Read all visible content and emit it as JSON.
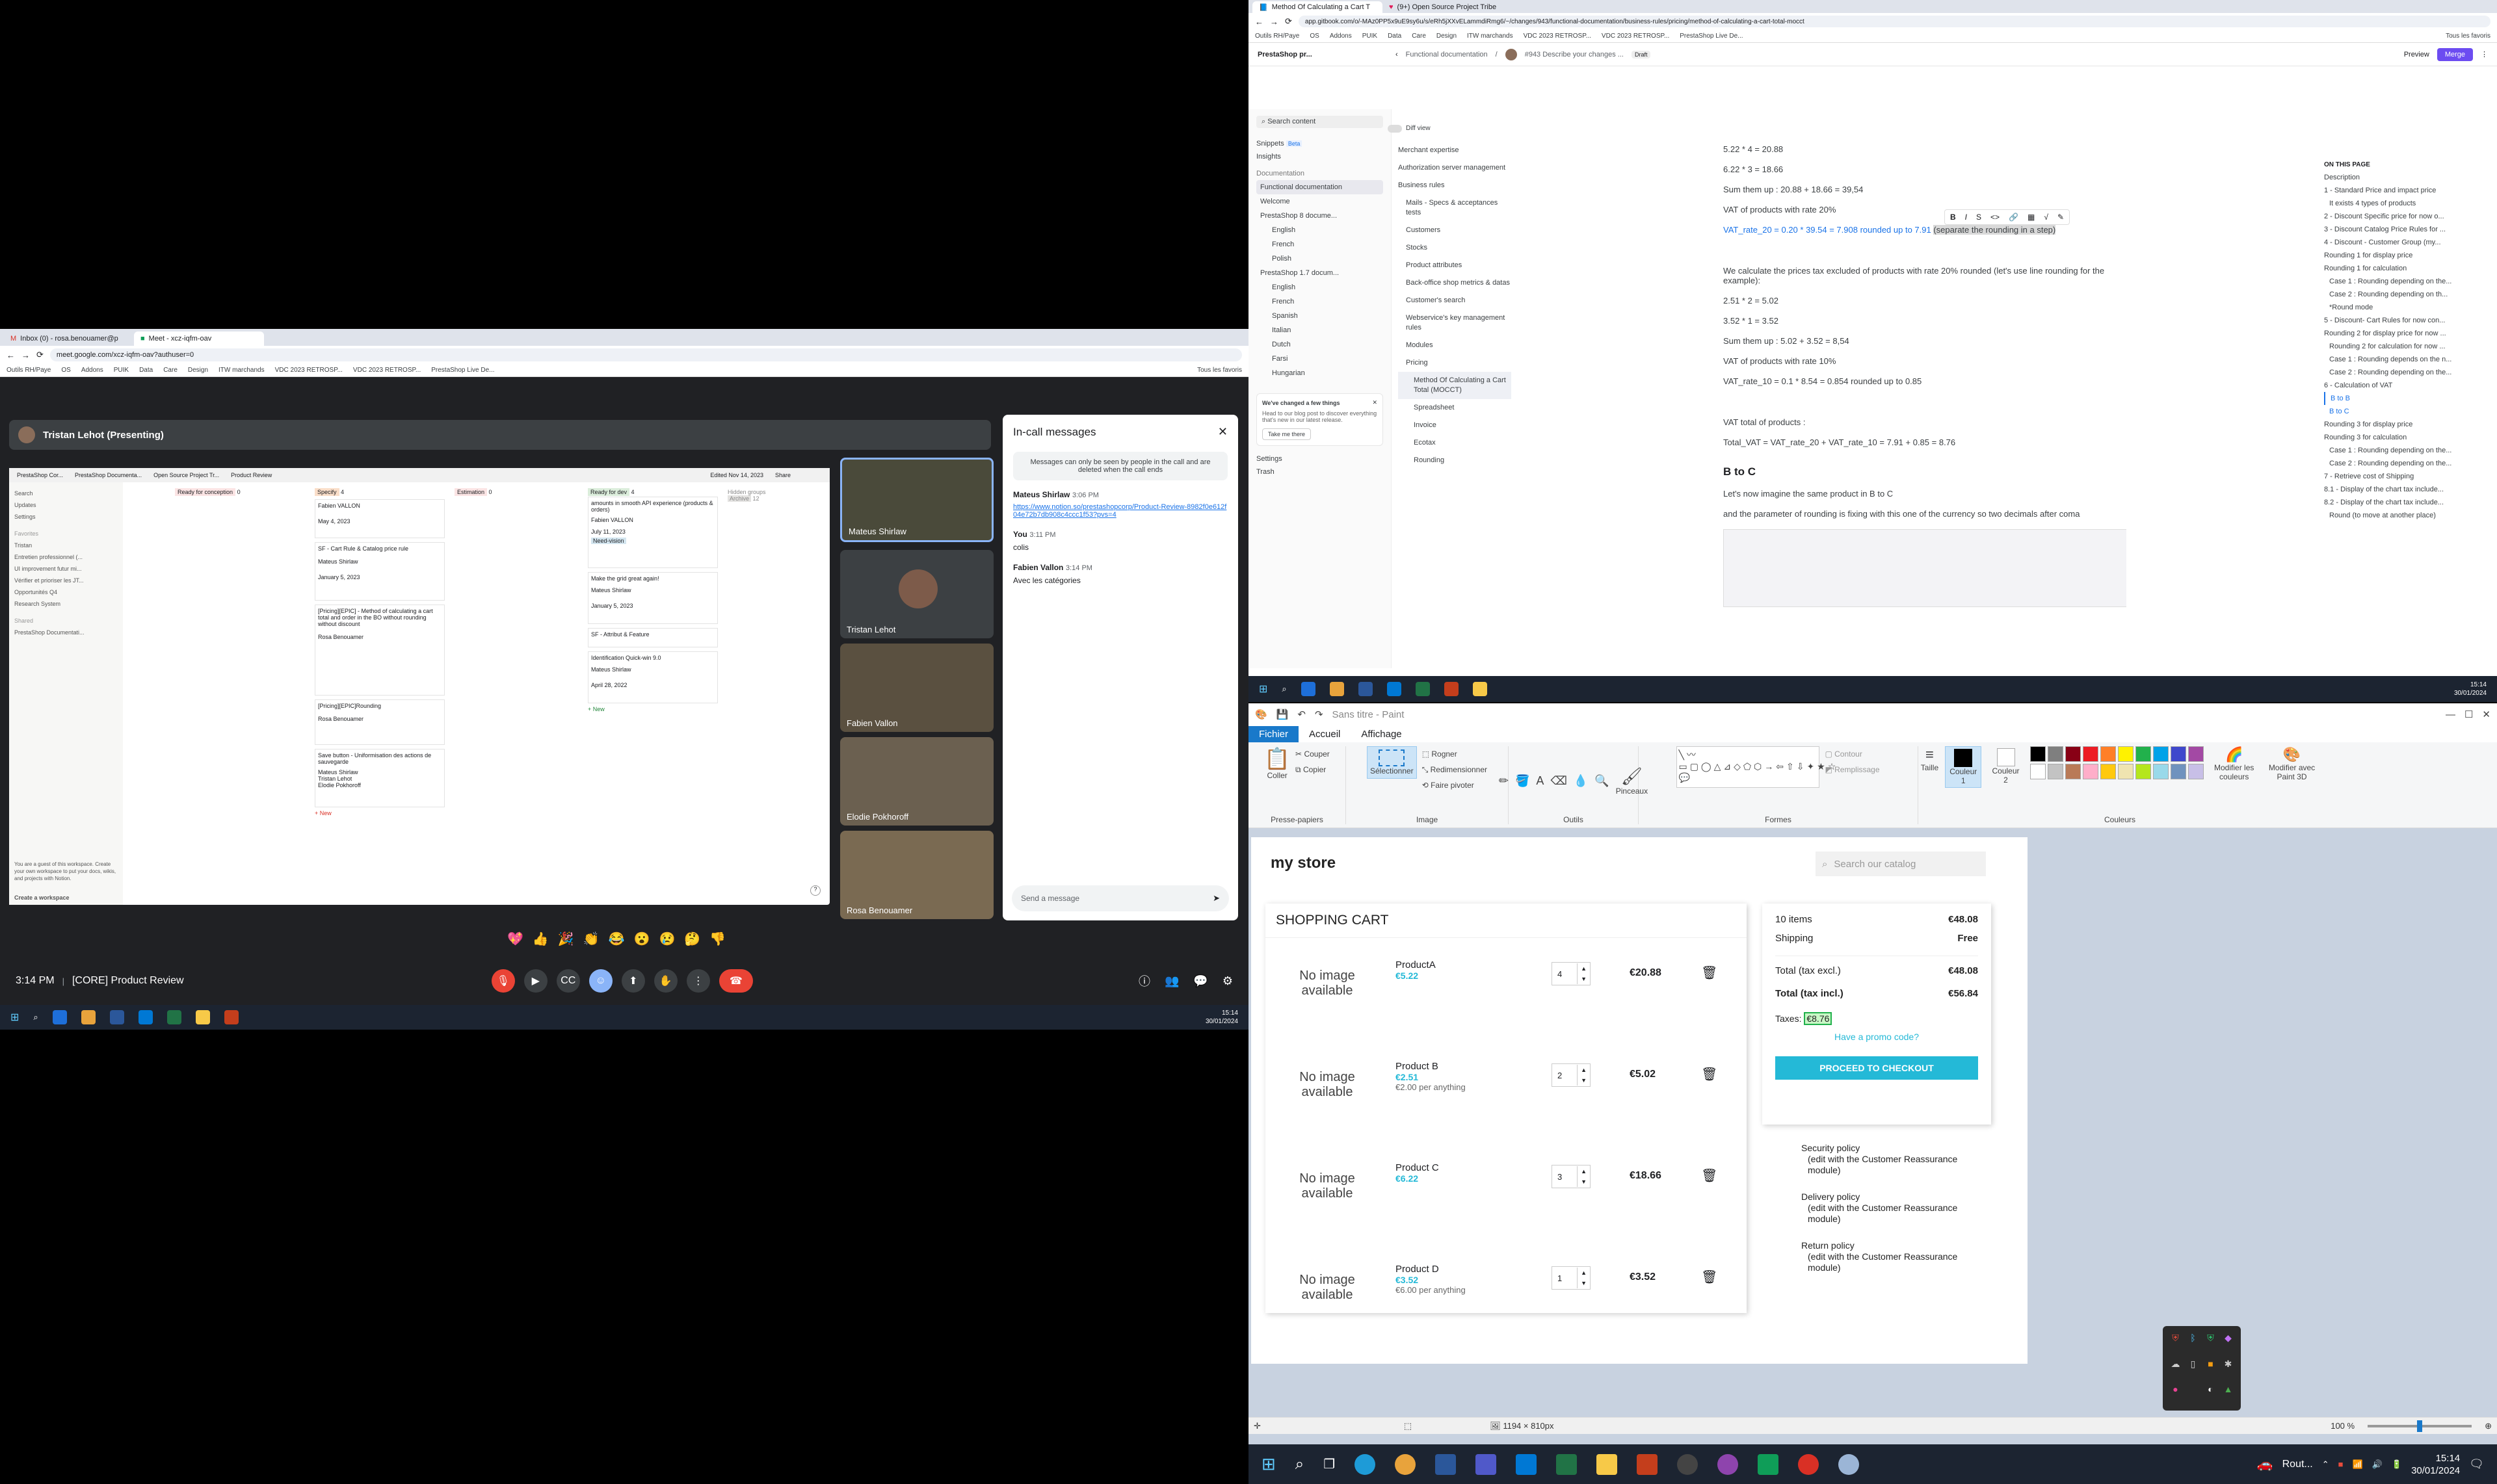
{
  "meet_browser": {
    "tabs": [
      {
        "label": "Inbox (0) - rosa.benouamer@p"
      },
      {
        "label": "Meet - xcz-iqfm-oav"
      }
    ],
    "url": "meet.google.com/xcz-iqfm-oav?authuser=0",
    "bookmarks": [
      "Outils RH/Paye",
      "OS",
      "Addons",
      "PUIK",
      "Data",
      "Care",
      "Design",
      "ITW marchands",
      "VDC 2023 RETROSP...",
      "VDC 2023 RETROSP...",
      "PrestaShop Live De..."
    ],
    "bookmarks_right": "Tous les favoris",
    "presenter": "Tristan Lehot (Presenting)",
    "shared": {
      "tabs": [
        "PrestaShop Cor...",
        "PrestaShop Documenta...",
        "Open Source Project Tr...",
        "Product Review"
      ],
      "edited": "Edited Nov 14, 2023",
      "share": "Share",
      "sidebar": [
        "Search",
        "Updates",
        "Settings",
        "Favorites",
        "Tristan",
        "Entretien professionnel (...",
        "UI improvement futur mi...",
        "Vérifier et prioriser les JT...",
        "Opportunités Q4",
        "Research System",
        "Shared",
        "PrestaShop Documentati..."
      ],
      "guest_note": "You are a guest of this workspace. Create your own workspace to put your docs, wikis, and projects with Notion.",
      "create": "Create a workspace",
      "columns": [
        {
          "title": "Ready for conception",
          "count": "0",
          "cards": []
        },
        {
          "title": "Specify",
          "count": "4",
          "cards": [
            {
              "owner": "Fabien VALLON",
              "date": "May 4, 2023"
            },
            {
              "title": "SF - Cart Rule & Catalog price rule",
              "owner": "Mateus Shirlaw",
              "date": "January 5, 2023"
            },
            {
              "title": "[Pricing][EPIC] - Method of calculating a cart total and order in the BO without rounding without discount",
              "owner": "Rosa Benouamer"
            },
            {
              "title": "[Pricing][EPIC]Rounding",
              "owner": "Rosa Benouamer"
            },
            {
              "title": "Save button - Uniformisation des actions de sauvegarde",
              "owner": "Mateus Shirlaw",
              "owner2": "Tristan Lehot",
              "owner3": "Elodie Pokhoroff"
            }
          ]
        },
        {
          "title": "Estimation",
          "count": "0",
          "cards": []
        },
        {
          "title": "Ready for dev",
          "count": "4",
          "cards": [
            {
              "title": "amounts in smooth API experience (products & orders)",
              "owner": "Fabien VALLON",
              "date": "July 11, 2023",
              "tag": "Need-vision"
            },
            {
              "title": "Make the grid great again!",
              "owner": "Mateus Shirlaw",
              "date": "January 5, 2023"
            },
            {
              "title": "SF - Attribut & Feature"
            },
            {
              "title": "Identification Quick-win 9.0",
              "owner": "Mateus Shirlaw",
              "date": "April 28, 2022"
            }
          ]
        },
        {
          "title": "Hidden groups",
          "count": "",
          "cards": [
            {
              "title": "Archive",
              "count": "12"
            }
          ]
        }
      ],
      "new_label": "+ New",
      "help": "?"
    },
    "participants": [
      {
        "name": "Mateus Shirlaw"
      },
      {
        "name": "Tristan Lehot"
      },
      {
        "name": "Fabien Vallon"
      },
      {
        "name": "Elodie Pokhoroff"
      },
      {
        "name": "Rosa Benouamer"
      }
    ],
    "chat": {
      "title": "In-call messages",
      "notice": "Messages can only be seen by people in the call and are deleted when the call ends",
      "messages": [
        {
          "sender": "Mateus Shirlaw",
          "time": "3:06 PM",
          "text": "https://www.notion.so/prestashopcorp/Product-Review-8982f0e612f04e72b7db908c4ccc1f53?pvs=4"
        },
        {
          "sender": "You",
          "time": "3:11 PM",
          "text": "colis"
        },
        {
          "sender": "Fabien Vallon",
          "time": "3:14 PM",
          "text": "Avec les catégories"
        }
      ],
      "input_placeholder": "Send a message"
    },
    "footer": {
      "time": "3:14 PM",
      "meeting": "[CORE] Product Review"
    },
    "reactions": [
      "💖",
      "👍",
      "🎉",
      "👏",
      "😂",
      "😮",
      "😢",
      "🤔",
      "👎"
    ],
    "taskbar_time": "15:14",
    "taskbar_date": "30/01/2024"
  },
  "gitbook_browser": {
    "tabs": [
      {
        "label": "Method Of Calculating a Cart T"
      },
      {
        "label": "(9+) Open Source Project Tribe"
      }
    ],
    "url": "app.gitbook.com/o/-MAz0PP5x9uE9sy6u/s/eRh5jXXvELammdiRmg6/~/changes/943/functional-documentation/business-rules/pricing/method-of-calculating-a-cart-total-mocct",
    "bookmarks": [
      "Outils RH/Paye",
      "OS",
      "Addons",
      "PUIK",
      "Data",
      "Care",
      "Design",
      "ITW marchands",
      "VDC 2023 RETROSP...",
      "VDC 2023 RETROSP...",
      "PrestaShop Live De..."
    ],
    "bookmarks_right": "Tous les favoris",
    "space": "PrestaShop pr...",
    "breadcrumb": "Functional documentation",
    "change_title": "#943 Describe your changes ...",
    "draft": "Draft",
    "preview": "Preview",
    "merge": "Merge",
    "search": "Search content",
    "diff_view": "Diff view",
    "left_nav": [
      "Snippets",
      "Insights",
      "Documentation",
      "Functional documentation",
      "Welcome",
      "PrestaShop 8 docume...",
      "English",
      "French",
      "Polish",
      "PrestaShop 1.7 docum...",
      "English",
      "French",
      "Spanish",
      "Italian",
      "Dutch",
      "Farsi",
      "Hungarian"
    ],
    "beta": "Beta",
    "promo": {
      "title": "We've changed a few things",
      "text": "Head to our blog post to discover everything that's new in our latest release.",
      "button": "Take me there"
    },
    "settings": "Settings",
    "trash": "Trash",
    "tree": [
      "Merchant expertise",
      "Authorization server management",
      "Business rules",
      "Mails - Specs & acceptances tests",
      "Customers",
      "Stocks",
      "Product attributes",
      "Back-office shop metrics & datas",
      "Customer's search",
      "Webservice's key management rules",
      "Modules",
      "Pricing",
      "Method Of Calculating a Cart Total (MOCCT)",
      "Spreadsheet",
      "Invoice",
      "Ecotax",
      "Rounding"
    ],
    "doc": [
      "5.22 * 4 = 20.88",
      "6.22 * 3 = 18.66",
      "Sum them up : 20.88 + 18.66 = 39,54",
      "VAT of products with rate 20%",
      "VAT_rate_20 = 0.20 * 39.54 = 7.908 rounded up to 7.91",
      "(separate the rounding in a step)",
      "We calculate the prices tax excluded of products with rate 20% rounded (let's use line rounding for the example):",
      "2.51 * 2 = 5.02",
      "3.52 * 1 = 3.52",
      "Sum them up : 5.02 + 3.52 = 8,54",
      "VAT of products with rate 10%",
      "VAT_rate_10 = 0.1 * 8.54 = 0.854 rounded up to 0.85",
      "VAT total of products :",
      "Total_VAT = VAT_rate_20 + VAT_rate_10 = 7.91 + 0.85 = 8.76",
      "B to C",
      "Let's now imagine the same product in B to C",
      "and the parameter of rounding is fixing with this one of the currency so two decimals after coma"
    ],
    "toc_title": "ON THIS PAGE",
    "toc": [
      "Description",
      "1 - Standard Price and impact price",
      "It exists 4 types of products",
      "2 - Discount Specific price for now o...",
      "3 - Discount Catalog Price Rules for ...",
      "4 - Discount - Customer Group (my...",
      "Rounding 1 for display price",
      "Rounding 1 for calculation",
      "Case 1 : Rounding depending on the...",
      "Case 2 : Rounding depending on th...",
      "*Round mode",
      "5 - Discount- Cart Rules for now con...",
      "Rounding 2 for display price for now ...",
      "Rounding 2 for calculation for now ...",
      "Case 1 : Rounding depends on the n...",
      "Case 2 : Rounding depending on the...",
      "6 - Calculation of VAT",
      "B to B",
      "B to C",
      "Rounding 3 for display price",
      "Rounding 3 for calculation",
      "Case 1 : Rounding depending on the...",
      "Case 2 : Rounding depending on the...",
      "7 - Retrieve cost of Shipping",
      "8.1 - Display of the chart tax include...",
      "8.2 - Display of the chart tax include...",
      "Round (to move at another place)"
    ],
    "taskbar_time": "15:14",
    "taskbar_date": "30/01/2024"
  },
  "paint": {
    "title": "Sans titre - Paint",
    "tabs": [
      "Fichier",
      "Accueil",
      "Affichage"
    ],
    "groups": {
      "clipboard": "Presse-papiers",
      "image": "Image",
      "tools": "Outils",
      "shapes": "Formes",
      "colors": "Couleurs"
    },
    "buttons": {
      "coller": "Coller",
      "couper": "Couper",
      "copier": "Copier",
      "selectionner": "Sélectionner",
      "rogner": "Rogner",
      "redimensionner": "Redimensionner",
      "faire_pivoter": "Faire pivoter",
      "pinceaux": "Pinceaux",
      "contour": "Contour",
      "remplissage": "Remplissage",
      "taille": "Taille",
      "couleur1": "Couleur 1",
      "couleur2": "Couleur 2",
      "modifier_couleurs": "Modifier les couleurs",
      "paint3d": "Modifier avec Paint 3D"
    },
    "palette": [
      "#000000",
      "#7f7f7f",
      "#880015",
      "#ed1c24",
      "#ff7f27",
      "#fff200",
      "#22b14c",
      "#00a2e8",
      "#3f48cc",
      "#a349a4",
      "#ffffff",
      "#c3c3c3",
      "#b97a57",
      "#ffaec9",
      "#ffc90e",
      "#efe4b0",
      "#b5e61d",
      "#99d9ea",
      "#7092be",
      "#c8bfe7"
    ],
    "status_size": "1194 × 810px",
    "zoom": "100 %"
  },
  "store": {
    "logo": "my store",
    "search_placeholder": "Search our catalog",
    "heading": "SHOPPING CART",
    "no_image": "No image available",
    "items": [
      {
        "name": "ProductA",
        "price": "€5.22",
        "unit": "",
        "qty": "4",
        "total": "€20.88"
      },
      {
        "name": "Product B",
        "price": "€2.51",
        "unit": "€2.00 per anything",
        "qty": "2",
        "total": "€5.02"
      },
      {
        "name": "Product C",
        "price": "€6.22",
        "unit": "",
        "qty": "3",
        "total": "€18.66"
      },
      {
        "name": "Product D",
        "price": "€3.52",
        "unit": "€6.00 per anything",
        "qty": "1",
        "total": "€3.52"
      }
    ],
    "summary": {
      "items_label": "10 items",
      "items_value": "€48.08",
      "shipping_label": "Shipping",
      "shipping_value": "Free",
      "excl_label": "Total (tax excl.)",
      "excl_value": "€48.08",
      "incl_label": "Total (tax incl.)",
      "incl_value": "€56.84",
      "taxes_label": "Taxes:",
      "taxes_value": "€8.76",
      "promo": "Have a promo code?",
      "checkout": "PROCEED TO CHECKOUT"
    },
    "reassurance": [
      {
        "title": "Security policy",
        "text": "(edit with the Customer Reassurance module)"
      },
      {
        "title": "Delivery policy",
        "text": "(edit with the Customer Reassurance module)"
      },
      {
        "title": "Return policy",
        "text": "(edit with the Customer Reassurance module)"
      }
    ]
  },
  "main_taskbar": {
    "weather": "Rout...",
    "time": "15:14",
    "date": "30/01/2024"
  }
}
